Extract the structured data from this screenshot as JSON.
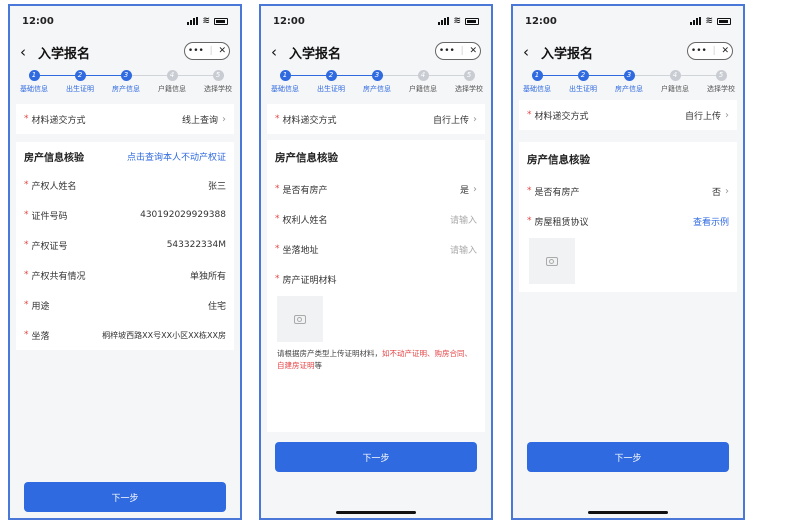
{
  "status": {
    "time": "12:00"
  },
  "nav": {
    "title": "入学报名",
    "capsule_more": "•••",
    "capsule_close": "✕"
  },
  "steps": [
    {
      "num": "1",
      "label": "基础信息"
    },
    {
      "num": "2",
      "label": "出生证明"
    },
    {
      "num": "3",
      "label": "房产信息"
    },
    {
      "num": "4",
      "label": "户籍信息"
    },
    {
      "num": "5",
      "label": "选择学校"
    }
  ],
  "next_label": "下一步",
  "screen1": {
    "material_label": "材料递交方式",
    "material_value": "线上查询",
    "section_title": "房产信息核验",
    "section_link": "点击查询本人不动产权证",
    "rows": [
      {
        "label": "产权人姓名",
        "value": "张三"
      },
      {
        "label": "证件号码",
        "value": "430192029929388"
      },
      {
        "label": "产权证号",
        "value": "543322334M"
      },
      {
        "label": "产权共有情况",
        "value": "单独所有"
      },
      {
        "label": "用途",
        "value": "住宅"
      },
      {
        "label": "坐落",
        "value": "桐梓坡西路XX号XX小区XX栋XX房"
      }
    ]
  },
  "screen2": {
    "material_label": "材料递交方式",
    "material_value": "自行上传",
    "section_title": "房产信息核验",
    "has_house_label": "是否有房产",
    "has_house_value": "是",
    "owner_label": "权利人姓名",
    "owner_placeholder": "请输入",
    "address_label": "坐落地址",
    "address_placeholder": "请输入",
    "cert_label": "房产证明材料",
    "hint_prefix": "请根据房产类型上传证明材料，",
    "hint_red": "如不动产证明、购房合同、自建房证明",
    "hint_suffix": "等"
  },
  "screen3": {
    "material_label": "材料递交方式",
    "material_value": "自行上传",
    "section_title": "房产信息核验",
    "has_house_label": "是否有房产",
    "has_house_value": "否",
    "lease_label": "房屋租赁协议",
    "lease_link": "查看示例"
  }
}
